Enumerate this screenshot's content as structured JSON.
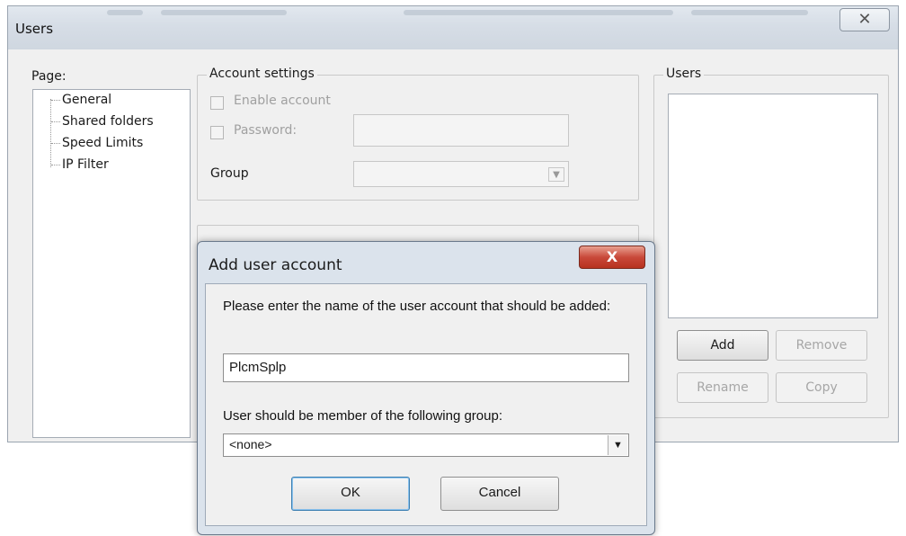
{
  "window": {
    "title": "Users",
    "close_glyph": "✕"
  },
  "page_panel": {
    "label": "Page:",
    "items": [
      {
        "label": "General"
      },
      {
        "label": "Shared folders"
      },
      {
        "label": "Speed Limits"
      },
      {
        "label": "IP Filter"
      }
    ]
  },
  "account_settings": {
    "legend": "Account settings",
    "enable_account_label": "Enable account",
    "password_label": "Password:",
    "password_value": "",
    "group_label": "Group",
    "group_value": ""
  },
  "users_panel": {
    "legend": "Users",
    "add_label": "Add",
    "remove_label": "Remove",
    "rename_label": "Rename",
    "copy_label": "Copy"
  },
  "dialog": {
    "title": "Add user account",
    "close_glyph": "X",
    "prompt": "Please enter the name of the user account that should be added:",
    "name_value": "PlcmSplp",
    "group_prompt": "User should be member of the following group:",
    "group_selected": "<none>",
    "ok_label": "OK",
    "cancel_label": "Cancel"
  },
  "icons": {
    "dropdown": "chevron-down-icon",
    "close": "close-icon"
  }
}
